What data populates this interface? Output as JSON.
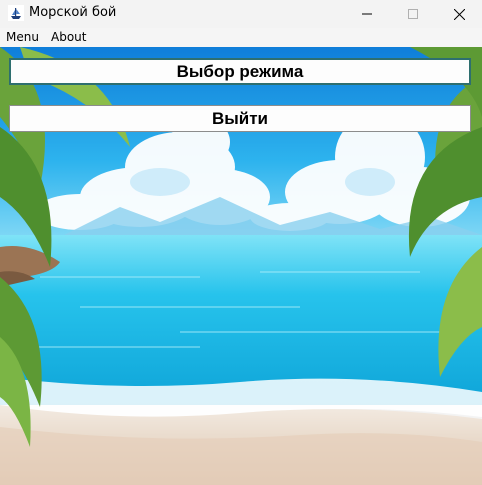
{
  "window": {
    "title": "Морской бой",
    "controls": {
      "minimize": "minimize-icon",
      "maximize": "maximize-icon",
      "close": "close-icon"
    }
  },
  "menubar": {
    "items": [
      "Menu",
      "About"
    ]
  },
  "main": {
    "mode_button": "Выбор режима",
    "exit_button": "Выйти"
  },
  "colors": {
    "sky": "#1aa6e8",
    "sea": "#22c7ee",
    "sand": "#e9dccb",
    "palm": "#6ca63c"
  }
}
